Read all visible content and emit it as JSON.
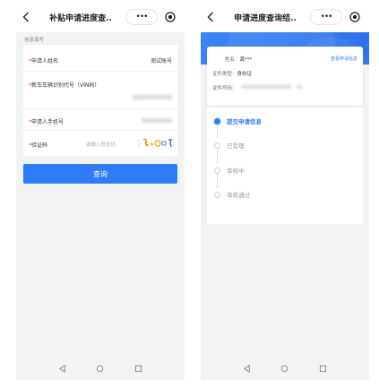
{
  "left": {
    "header": {
      "title": "补贴申请进度查..",
      "menu_label": "•••"
    },
    "section_label": "信息填写",
    "fields": {
      "applicant_name": {
        "label": "申请人姓名",
        "value": "测试账号"
      },
      "vin": {
        "label": "新车车辆识别代号（VIN码）"
      },
      "phone": {
        "label": "申请人手机号"
      },
      "captcha": {
        "label": "验证码",
        "placeholder": "请输入验证码"
      }
    },
    "required_mark": "*",
    "query_button": "查询"
  },
  "right": {
    "header": {
      "title": "申请进度查询结..",
      "menu_label": "•••"
    },
    "info": {
      "name_key": "姓名：",
      "name_value": "龚***",
      "id_type_key": "证件类型：",
      "id_type_value": "身份证",
      "id_no_key": "证件号码：",
      "view_link": "查看申请信息"
    },
    "steps": [
      {
        "label": "提交申请信息",
        "active": true
      },
      {
        "label": "已受理",
        "active": false
      },
      {
        "label": "审核中",
        "active": false
      },
      {
        "label": "审核通过",
        "active": false
      }
    ]
  },
  "colors": {
    "primary": "#2f7df6",
    "required": "#e53935",
    "page_bg": "#f2f3f5"
  }
}
